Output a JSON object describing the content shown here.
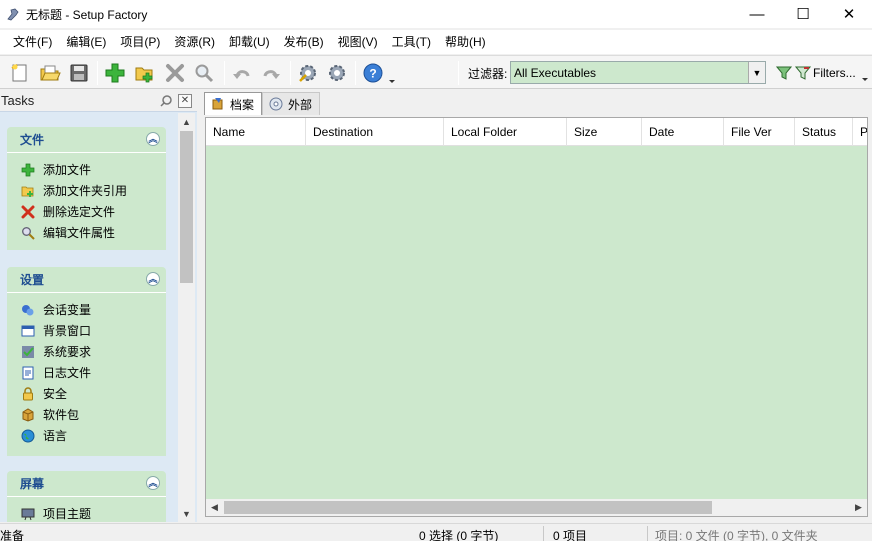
{
  "window": {
    "title": "无标题 - Setup Factory",
    "minimize": "—",
    "maximize": "☐",
    "close": "✕"
  },
  "menu": [
    {
      "label": "文件(F)"
    },
    {
      "label": "编辑(E)"
    },
    {
      "label": "项目(P)"
    },
    {
      "label": "资源(R)"
    },
    {
      "label": "卸载(U)"
    },
    {
      "label": "发布(B)"
    },
    {
      "label": "视图(V)"
    },
    {
      "label": "工具(T)"
    },
    {
      "label": "帮助(H)"
    }
  ],
  "toolbar": {
    "filter_label": "过滤器:",
    "filter_value": "All Executables",
    "filters_button": "Filters..."
  },
  "tasks": {
    "title": "Tasks",
    "groups": [
      {
        "title": "文件",
        "items": [
          {
            "label": "添加文件",
            "icon": "add-icon"
          },
          {
            "label": "添加文件夹引用",
            "icon": "folder-add-icon"
          },
          {
            "label": "删除选定文件",
            "icon": "delete-icon"
          },
          {
            "label": "编辑文件属性",
            "icon": "search-icon"
          }
        ]
      },
      {
        "title": "设置",
        "items": [
          {
            "label": "会话变量",
            "icon": "session-vars-icon"
          },
          {
            "label": "背景窗口",
            "icon": "window-icon"
          },
          {
            "label": "系统要求",
            "icon": "system-req-icon"
          },
          {
            "label": "日志文件",
            "icon": "log-file-icon"
          },
          {
            "label": "安全",
            "icon": "lock-icon"
          },
          {
            "label": "软件包",
            "icon": "package-icon"
          },
          {
            "label": "语言",
            "icon": "globe-icon"
          }
        ]
      },
      {
        "title": "屏幕",
        "items": [
          {
            "label": "项目主题",
            "icon": "theme-icon"
          }
        ]
      }
    ]
  },
  "tabs": [
    {
      "label": "档案",
      "icon": "archive-icon"
    },
    {
      "label": "外部",
      "icon": "cd-icon"
    }
  ],
  "columns": [
    "Name",
    "Destination",
    "Local Folder",
    "Size",
    "Date",
    "File Ver",
    "Status",
    "P"
  ],
  "status": {
    "ready": "准备",
    "selection": "0 选择 (0 字节)",
    "items": "0 项目",
    "summary": "项目: 0 文件 (0 字节), 0 文件夹"
  },
  "colors": {
    "grid_bg": "#cde8cd",
    "panel_bg": "#dde9f4",
    "group_title": "#1f4e91"
  }
}
